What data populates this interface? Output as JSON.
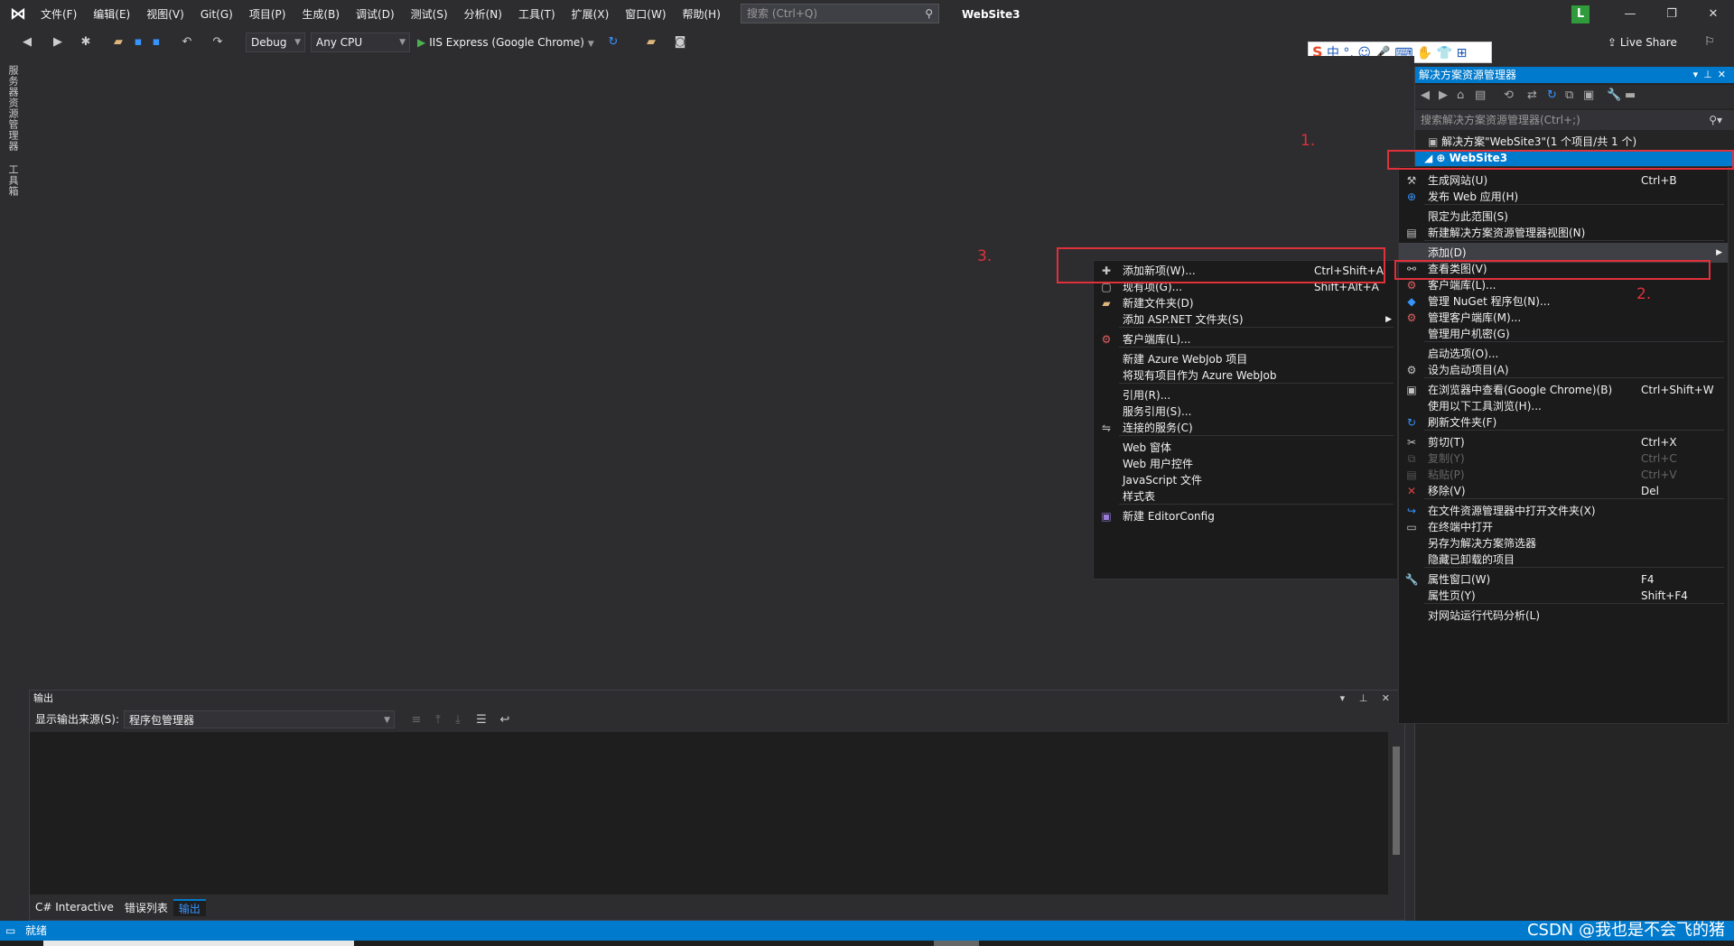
{
  "titlebar": {
    "menu": [
      "文件(F)",
      "编辑(E)",
      "视图(V)",
      "Git(G)",
      "项目(P)",
      "生成(B)",
      "调试(D)",
      "测试(S)",
      "分析(N)",
      "工具(T)",
      "扩展(X)",
      "窗口(W)",
      "帮助(H)"
    ],
    "search_placeholder": "搜索 (Ctrl+Q)",
    "solution_name": "WebSite3",
    "user_initial": "L"
  },
  "toolbar": {
    "config": "Debug",
    "platform": "Any CPU",
    "run_target": "IIS Express (Google Chrome)",
    "live_share": "Live Share"
  },
  "ime": {
    "text": "中 °, ☺ 🎤 ⌨ ✋ 👕 ⊞"
  },
  "left_tabs": [
    "服务器资源管理器",
    "工具箱"
  ],
  "output": {
    "title": "输出",
    "source_label": "显示输出来源(S):",
    "source_value": "程序包管理器",
    "tabs": [
      "C# Interactive",
      "错误列表",
      "输出"
    ],
    "active_tab": "输出"
  },
  "solution_explorer": {
    "title": "解决方案资源管理器",
    "search_placeholder": "搜索解决方案资源管理器(Ctrl+;)",
    "solution_node": "解决方案\"WebSite3\"(1 个项目/共 1 个)",
    "project_node": "WebSite3"
  },
  "project_menu": [
    {
      "label": "生成网站(U)",
      "shortcut": "Ctrl+B",
      "icon": "build-icon"
    },
    {
      "label": "发布 Web 应用(H)",
      "shortcut": "",
      "icon": "globe-icon"
    },
    {
      "label": "限定为此范围(S)",
      "shortcut": "",
      "icon": ""
    },
    {
      "label": "新建解决方案资源管理器视图(N)",
      "shortcut": "",
      "icon": "new-view-icon"
    },
    {
      "label": "添加(D)",
      "shortcut": "",
      "icon": "",
      "submenu": true,
      "highlight": true
    },
    {
      "label": "查看类图(V)",
      "shortcut": "",
      "icon": "class-diagram-icon"
    },
    {
      "label": "客户端库(L)...",
      "shortcut": "",
      "icon": "library-icon"
    },
    {
      "label": "管理 NuGet 程序包(N)...",
      "shortcut": "",
      "icon": "nuget-icon"
    },
    {
      "label": "管理客户端库(M)...",
      "shortcut": "",
      "icon": "library-icon"
    },
    {
      "label": "管理用户机密(G)",
      "shortcut": "",
      "icon": ""
    },
    {
      "label": "启动选项(O)...",
      "shortcut": "",
      "icon": ""
    },
    {
      "label": "设为启动项目(A)",
      "shortcut": "",
      "icon": "gear-icon"
    },
    {
      "label": "在浏览器中查看(Google Chrome)(B)",
      "shortcut": "Ctrl+Shift+W",
      "icon": "browser-icon"
    },
    {
      "label": "使用以下工具浏览(H)...",
      "shortcut": "",
      "icon": ""
    },
    {
      "label": "刷新文件夹(F)",
      "shortcut": "",
      "icon": "refresh-icon"
    },
    {
      "label": "剪切(T)",
      "shortcut": "Ctrl+X",
      "icon": "cut-icon"
    },
    {
      "label": "复制(Y)",
      "shortcut": "Ctrl+C",
      "icon": "copy-icon",
      "disabled": true
    },
    {
      "label": "粘贴(P)",
      "shortcut": "Ctrl+V",
      "icon": "paste-icon",
      "disabled": true
    },
    {
      "label": "移除(V)",
      "shortcut": "Del",
      "icon": "remove-icon"
    },
    {
      "label": "在文件资源管理器中打开文件夹(X)",
      "shortcut": "",
      "icon": "open-folder-icon"
    },
    {
      "label": "在终端中打开",
      "shortcut": "",
      "icon": "terminal-icon"
    },
    {
      "label": "另存为解决方案筛选器",
      "shortcut": "",
      "icon": ""
    },
    {
      "label": "隐藏已卸载的项目",
      "shortcut": "",
      "icon": ""
    },
    {
      "label": "属性窗口(W)",
      "shortcut": "F4",
      "icon": "wrench-icon"
    },
    {
      "label": "属性页(Y)",
      "shortcut": "Shift+F4",
      "icon": ""
    },
    {
      "label": "对网站运行代码分析(L)",
      "shortcut": "",
      "icon": ""
    }
  ],
  "add_menu": [
    {
      "label": "添加新项(W)...",
      "shortcut": "Ctrl+Shift+A",
      "icon": "new-item-icon"
    },
    {
      "label": "现有项(G)...",
      "shortcut": "Shift+Alt+A",
      "icon": "existing-item-icon"
    },
    {
      "label": "新建文件夹(D)",
      "shortcut": "",
      "icon": "folder-icon"
    },
    {
      "label": "添加 ASP.NET 文件夹(S)",
      "shortcut": "",
      "icon": "",
      "submenu": true
    },
    {
      "label": "客户端库(L)...",
      "shortcut": "",
      "icon": "library-icon"
    },
    {
      "label": "新建 Azure WebJob 项目",
      "shortcut": "",
      "icon": ""
    },
    {
      "label": "将现有项目作为 Azure WebJob",
      "shortcut": "",
      "icon": ""
    },
    {
      "label": "引用(R)...",
      "shortcut": "",
      "icon": ""
    },
    {
      "label": "服务引用(S)...",
      "shortcut": "",
      "icon": ""
    },
    {
      "label": "连接的服务(C)",
      "shortcut": "",
      "icon": "connected-service-icon"
    },
    {
      "label": "Web 窗体",
      "shortcut": "",
      "icon": ""
    },
    {
      "label": "Web 用户控件",
      "shortcut": "",
      "icon": ""
    },
    {
      "label": "JavaScript 文件",
      "shortcut": "",
      "icon": ""
    },
    {
      "label": "样式表",
      "shortcut": "",
      "icon": ""
    },
    {
      "label": "新建 EditorConfig",
      "shortcut": "",
      "icon": "editorconfig-icon"
    }
  ],
  "annotations": [
    "1.",
    "2.",
    "3."
  ],
  "status": {
    "text": "就绪",
    "watermark": "CSDN @我也是不会飞的猪"
  }
}
